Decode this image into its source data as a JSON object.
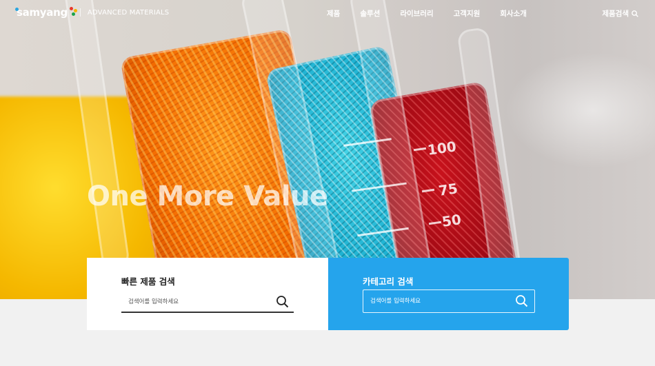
{
  "header": {
    "logo_text": "samyang",
    "logo_sub": "ADVANCED MATERIALS",
    "nav": [
      "제품",
      "솔루션",
      "라이브러리",
      "고객지원",
      "회사소개"
    ],
    "product_search_label": "제품검색"
  },
  "hero": {
    "slogan": "One More Value",
    "scale_marks": [
      "100",
      "75",
      "50"
    ]
  },
  "quick_search": {
    "title": "빠른 제품 검색",
    "placeholder": "검색어를 입력하세요"
  },
  "category_search": {
    "title": "카테고리 검색",
    "placeholder": "검색어를 입력하세요"
  },
  "colors": {
    "accent_blue": "#25a4ec",
    "logo_dots": [
      "#2aa6e0",
      "#e8392b",
      "#f4b400",
      "#1aa34a"
    ]
  }
}
